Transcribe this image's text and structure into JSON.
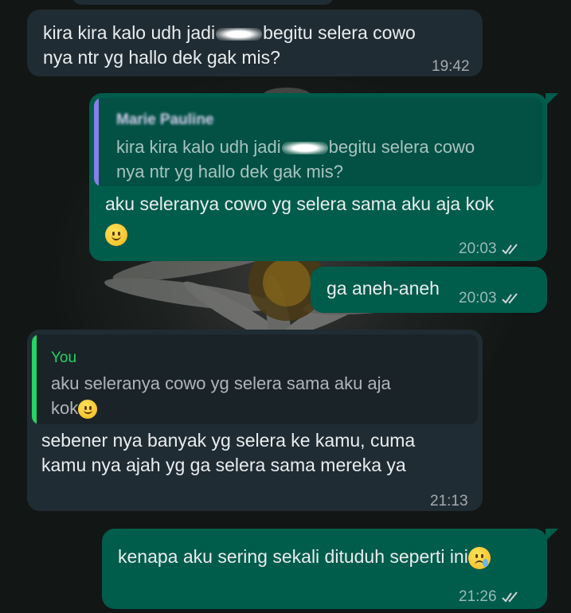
{
  "colors": {
    "incoming_bubble": "#202c33",
    "outgoing_bubble": "#005c4b",
    "quote_name_you": "#25d366",
    "quote_bar_you": "#25d366",
    "quote_bar_other": "#8a7ee8",
    "read_ticks": "#d0d6d8"
  },
  "messages": [
    {
      "direction": "incoming",
      "text_before": "kira kira kalo udh jadi",
      "text_after": "begitu selera cowo",
      "text_line2": "nya ntr yg hallo dek gak mis?",
      "time": "19:42"
    },
    {
      "direction": "outgoing",
      "quote": {
        "name": "Marie Pauline",
        "text_before": "kira kira kalo udh jadi",
        "text_after": "begitu selera cowo",
        "text_line2": "nya ntr yg hallo dek gak mis?"
      },
      "text": "aku seleranya cowo yg selera sama aku aja kok",
      "emoji": "slightly-smiling-face",
      "time": "20:03",
      "status_icon": "double-check-icon"
    },
    {
      "direction": "outgoing",
      "text": "ga aneh-aneh",
      "time": "20:03",
      "status_icon": "double-check-icon"
    },
    {
      "direction": "incoming",
      "quote": {
        "name": "You",
        "text_line1": "aku seleranya cowo yg selera sama aku aja",
        "text_line2": "kok"
      },
      "text_line1": "sebener nya banyak yg selera ke kamu, cuma",
      "text_line2": "kamu nya ajah yg ga selera sama mereka ya",
      "time": "21:13"
    },
    {
      "direction": "outgoing",
      "text": "kenapa aku sering sekali dituduh seperti ini",
      "emoji": "crying-face",
      "time": "21:26",
      "status_icon": "double-check-icon"
    }
  ]
}
